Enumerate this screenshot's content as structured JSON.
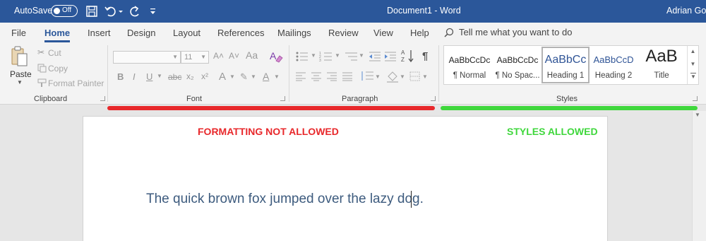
{
  "titlebar": {
    "autosave_label": "AutoSave",
    "autosave_state": "Off",
    "document_title": "Document1  -  Word",
    "user_name": "Adrian Gor"
  },
  "tabs": [
    "File",
    "Home",
    "Insert",
    "Design",
    "Layout",
    "References",
    "Mailings",
    "Review",
    "View",
    "Help"
  ],
  "active_tab": "Home",
  "tell_me": "Tell me what you want to do",
  "clipboard": {
    "paste": "Paste",
    "cut": "Cut",
    "copy": "Copy",
    "format_painter": "Format Painter",
    "label": "Clipboard"
  },
  "font": {
    "size": "11",
    "label": "Font"
  },
  "paragraph": {
    "label": "Paragraph"
  },
  "styles": {
    "items": [
      {
        "sample": "AaBbCcDc",
        "name": "¶ Normal"
      },
      {
        "sample": "AaBbCcDc",
        "name": "¶ No Spac..."
      },
      {
        "sample": "AaBbCc",
        "name": "Heading 1"
      },
      {
        "sample": "AaBbCcD",
        "name": "Heading 2"
      },
      {
        "sample": "AaB",
        "name": "Title"
      }
    ],
    "selected_index": 2,
    "label": "Styles"
  },
  "annotations": {
    "formatting": "FORMATTING NOT ALLOWED",
    "styles": "STYLES ALLOWED"
  },
  "document": {
    "body_text": "The quick brown fox jumped over the lazy dog."
  },
  "colors": {
    "titlebar": "#2b579a",
    "not_allowed": "#e8282b",
    "allowed": "#3fd73c",
    "heading_text": "#3d5b7e"
  }
}
